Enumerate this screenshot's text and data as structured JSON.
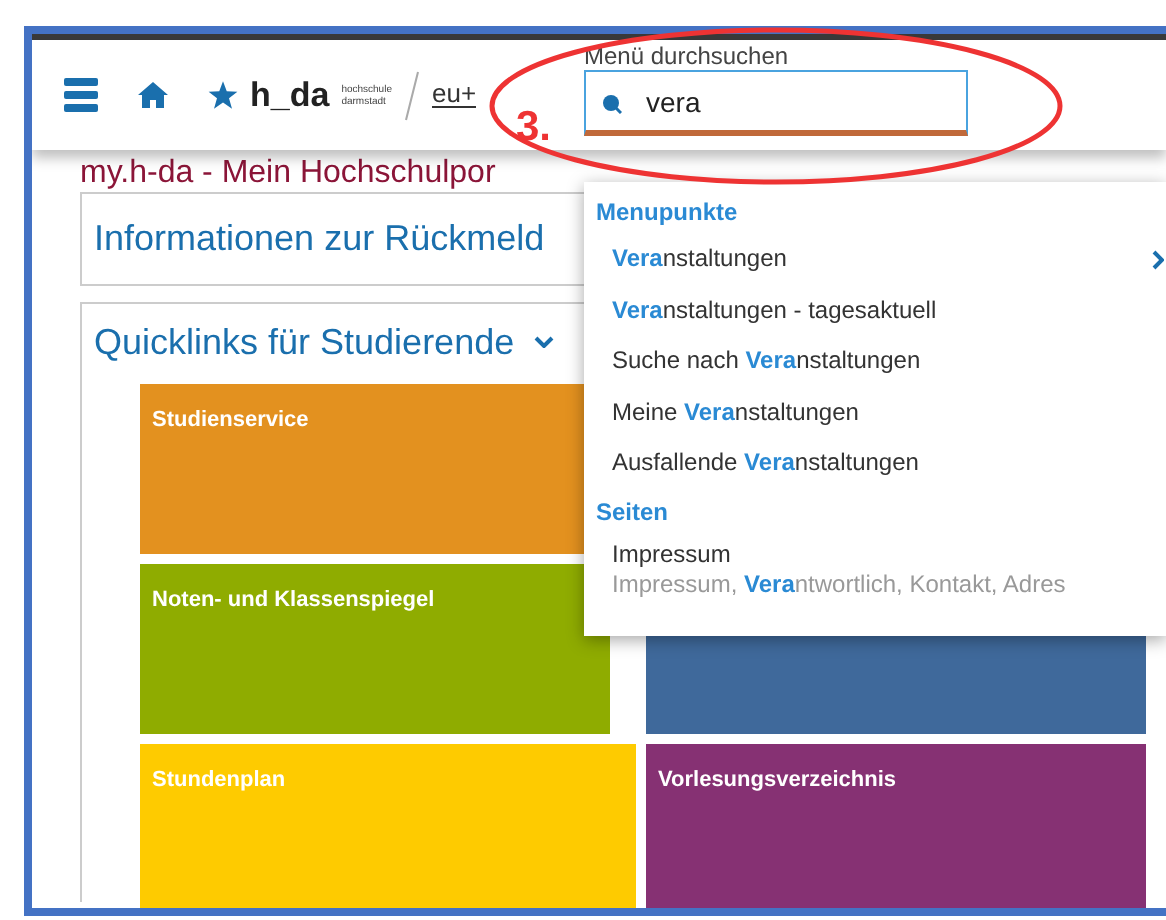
{
  "header": {
    "logo_text": "h_da",
    "logo_subtext": [
      "hochschule",
      "darmstadt"
    ],
    "partner_logo": "eu+"
  },
  "search": {
    "label": "Menü durchsuchen",
    "value": "vera"
  },
  "annotation": {
    "label": "3."
  },
  "page_title": "my.h-da - Mein Hochschulpor",
  "info_card": {
    "title": "Informationen zur Rückmeld"
  },
  "quicklinks": {
    "title": "Quicklinks für Studierende",
    "expanded": true,
    "tiles": [
      {
        "label": "Studienservice",
        "color": "#e3911f"
      },
      {
        "label": "Noten- und Klassenspiegel",
        "color": "#8fac00"
      },
      {
        "color": "#3f699b"
      },
      {
        "label": "Stundenplan",
        "color": "#fecb00"
      },
      {
        "label": "Vorlesungsverzeichnis",
        "color": "#863173"
      }
    ]
  },
  "results": [
    {
      "heading": "Menupunkte",
      "items": [
        {
          "text": "**Vera**nstaltungen",
          "has_submenu": true
        },
        {
          "text": "**Vera**nstaltungen - tagesaktuell",
          "has_submenu": false
        },
        {
          "text": "Suche nach **Vera**nstaltungen",
          "has_submenu": false
        },
        {
          "text": "Meine **Vera**nstaltungen",
          "has_submenu": false
        },
        {
          "text": "Ausfallende **Vera**nstaltungen",
          "has_submenu": false
        }
      ]
    },
    {
      "heading": "Seiten",
      "items": [
        {
          "text": "Impressum",
          "subtitle": "Impressum, **Vera**ntwortlich, Kontakt, Adres",
          "has_submenu": false
        }
      ]
    }
  ]
}
